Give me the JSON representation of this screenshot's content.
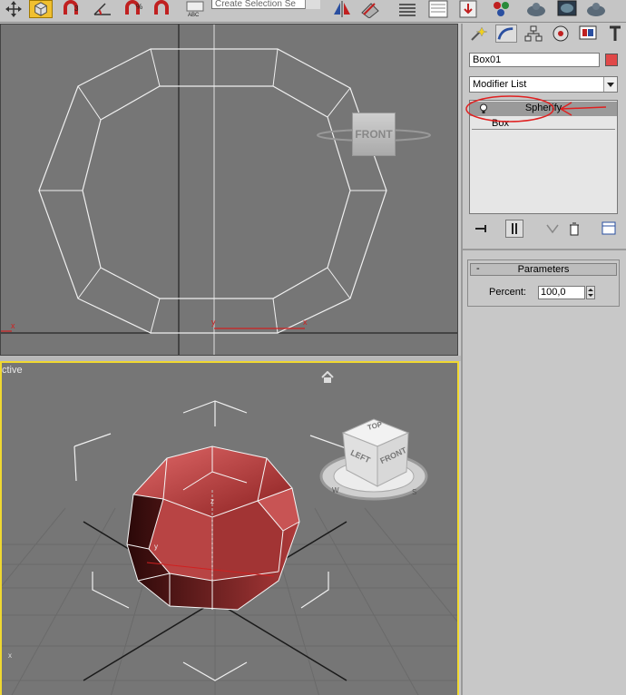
{
  "toolbar": {
    "selection_set": "Create Selection Se",
    "icons": [
      "select-move-icon",
      "select-box-icon",
      "magnet-3d-icon",
      "angle-snap-icon",
      "percent-snap-icon",
      "spinner-snap-icon",
      "spelling-icon",
      "mirror-icon",
      "align-icon",
      "layers-icon",
      "curve-editor-icon",
      "schematic-icon",
      "material-editor-icon",
      "render-setup-icon",
      "rendered-frame-icon",
      "render-icon"
    ]
  },
  "viewport_front": {
    "label": "",
    "viewcube_label": "FRONT",
    "axis_x": "x",
    "axis_y": "y"
  },
  "viewport_perspective": {
    "label": "ctive",
    "viewcube": {
      "top": "TOP",
      "left": "LEFT",
      "front": "FRONT"
    },
    "compass": [
      "W",
      "S"
    ],
    "object_color": "#c84a4a",
    "axis_labels": [
      "z",
      "y",
      "x"
    ]
  },
  "command_panel": {
    "tabs": [
      "create-icon",
      "modify-icon",
      "hierarchy-icon",
      "motion-icon",
      "display-icon",
      "utilities-icon"
    ],
    "object_name": "Box01",
    "object_color": "#e04848",
    "modifier_list": "Modifier List",
    "stack": {
      "selected": "Spherify",
      "base": "Box"
    },
    "stack_tools": [
      "pin-stack-icon",
      "show-end-result-icon",
      "make-unique-icon",
      "remove-modifier-icon",
      "configure-sets-icon"
    ],
    "rollout": {
      "title": "Parameters",
      "collapse": "-",
      "percent_label": "Percent:",
      "percent_value": "100,0"
    }
  },
  "annotation": {
    "color": "#e02020"
  }
}
